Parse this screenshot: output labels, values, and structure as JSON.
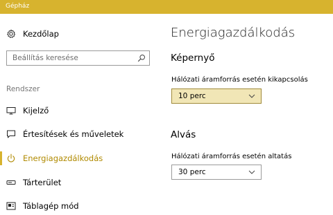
{
  "window": {
    "title": "Gépház",
    "accent_color": "#d7b32e"
  },
  "sidebar": {
    "home": {
      "label": "Kezdőlap",
      "icon": "gear-icon"
    },
    "search": {
      "placeholder": "Beállítás keresése",
      "icon": "search-icon"
    },
    "section_header": "Rendszer",
    "items": [
      {
        "label": "Kijelző",
        "icon": "display-icon",
        "active": false
      },
      {
        "label": "Értesítések és műveletek",
        "icon": "notification-icon",
        "active": false
      },
      {
        "label": "Energiagazdálkodás",
        "icon": "power-icon",
        "active": true
      },
      {
        "label": "Tárterület",
        "icon": "storage-icon",
        "active": false
      },
      {
        "label": "Táblagép mód",
        "icon": "tablet-mode-icon",
        "active": false
      }
    ]
  },
  "main": {
    "title": "Energiagazdálkodás",
    "screen": {
      "title": "Képernyő",
      "field_label": "Hálózati áramforrás esetén kikapcsolás",
      "value": "10 perc"
    },
    "sleep": {
      "title": "Alvás",
      "field_label": "Hálózati áramforrás esetén altatás",
      "value": "30 perc"
    }
  }
}
